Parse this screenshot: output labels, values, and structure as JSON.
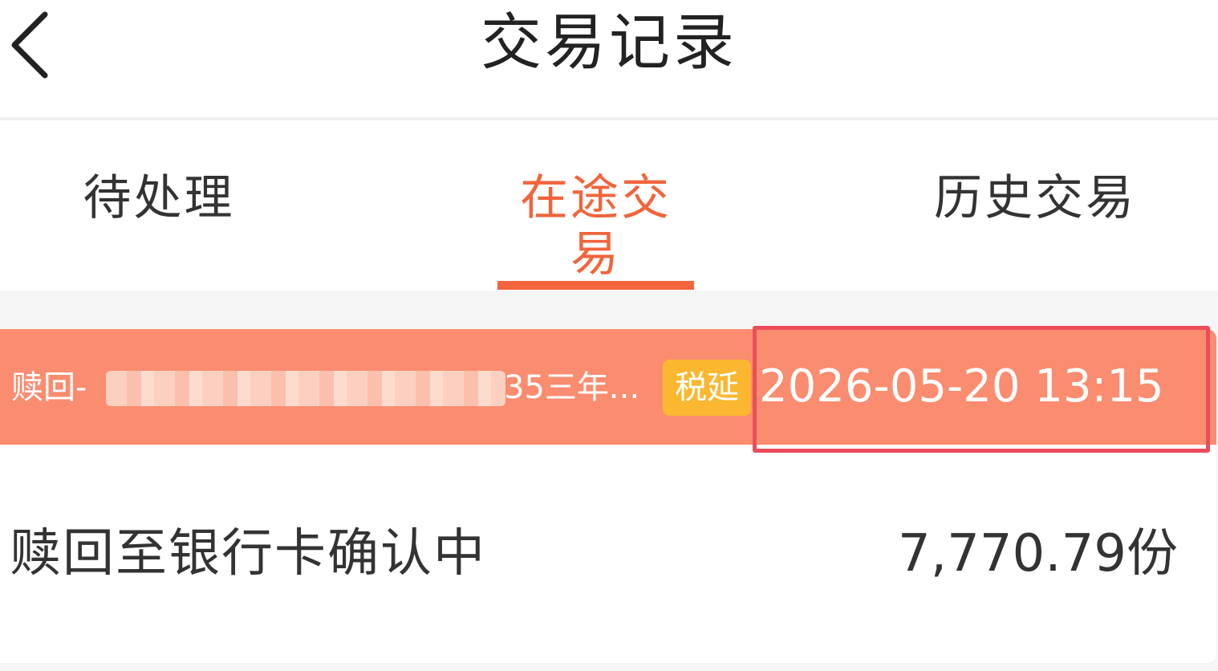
{
  "header": {
    "title": "交易记录",
    "back_icon": "chevron-left-icon"
  },
  "tabs": [
    {
      "label": "待处理",
      "active": false
    },
    {
      "label": "在途交易",
      "active": true
    },
    {
      "label": "历史交易",
      "active": false
    }
  ],
  "colors": {
    "accent": "#f2643c",
    "card_header": "#fa8c6f",
    "badge": "#fbb72f",
    "highlight_border": "#ec4c5c"
  },
  "record": {
    "product_prefix": "赎回-",
    "product_suffix": "35三年...",
    "tax_badge": "税延",
    "time": "2026-05-20 13:15",
    "status": "赎回至银行卡确认中",
    "amount": "7,770.79份"
  }
}
